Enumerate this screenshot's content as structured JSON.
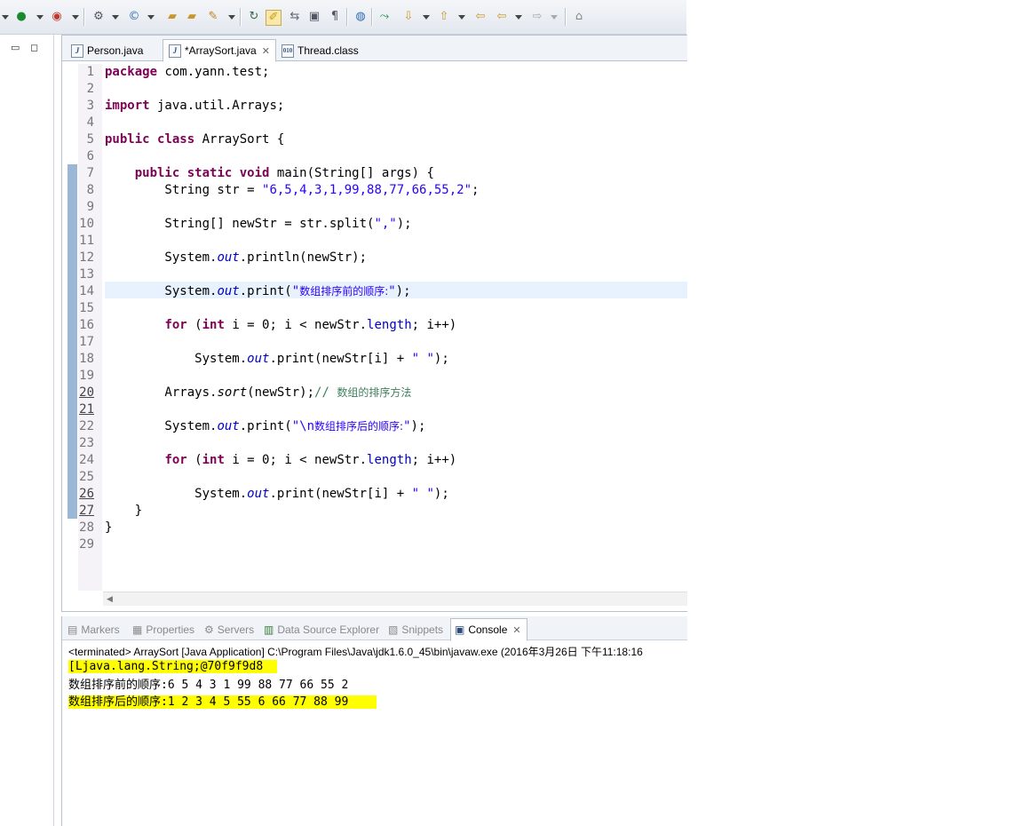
{
  "toolbar": {
    "icons": [
      "debug-icon",
      "run-icon",
      "external-tools-icon",
      "new-server-icon",
      "new-java-class-icon",
      "open-folder-icon",
      "open-type-icon",
      "search-icon",
      "toggle-mark-occurrences-icon",
      "toggle-highlight-icon",
      "toggle-block-icon",
      "show-whitespace-icon",
      "globe-icon",
      "next-annotation-icon",
      "previous-annotation-icon",
      "back-icon",
      "forward-icon",
      "pin-icon"
    ]
  },
  "editor": {
    "tabs": [
      {
        "label": "Person.java",
        "active": false,
        "closable": false
      },
      {
        "label": "*ArraySort.java",
        "active": true,
        "closable": true
      },
      {
        "label": "Thread.class",
        "active": false,
        "closable": false
      }
    ],
    "close_glyph": "✕",
    "code_lines": [
      "package com.yann.test;",
      "",
      "import java.util.Arrays;",
      "",
      "public class ArraySort {",
      "",
      "    public static void main(String[] args) {",
      "        String str = \"6,5,4,3,1,99,88,77,66,55,2\";",
      "",
      "        String[] newStr = str.split(\",\");",
      "",
      "        System.out.println(newStr);",
      "",
      "        System.out.print(\"数组排序前的顺序:\");",
      "",
      "        for (int i = 0; i < newStr.length; i++)",
      "",
      "            System.out.print(newStr[i] + \" \");",
      "",
      "        Arrays.sort(newStr);// 数组的排序方法",
      "",
      "        System.out.print(\"\\n数组排序后的顺序:\");",
      "",
      "        for (int i = 0; i < newStr.length; i++)",
      "",
      "            System.out.print(newStr[i] + \" \");",
      "    }",
      "}",
      ""
    ],
    "line_numbers": [
      "1",
      "2",
      "3",
      "4",
      "5",
      "6",
      "7",
      "8",
      "9",
      "10",
      "11",
      "12",
      "13",
      "14",
      "15",
      "16",
      "17",
      "18",
      "19",
      "20",
      "21",
      "22",
      "23",
      "24",
      "25",
      "26",
      "27",
      "28",
      "29"
    ]
  },
  "console": {
    "tabs": [
      {
        "label": "Markers",
        "icon": "markers-icon",
        "active": false
      },
      {
        "label": "Properties",
        "icon": "properties-icon",
        "active": false
      },
      {
        "label": "Servers",
        "icon": "servers-icon",
        "active": false
      },
      {
        "label": "Data Source Explorer",
        "icon": "data-source-icon",
        "active": false
      },
      {
        "label": "Snippets",
        "icon": "snippets-icon",
        "active": false
      },
      {
        "label": "Console",
        "icon": "console-icon",
        "active": true
      }
    ],
    "close_glyph": "✕",
    "terminated_line": "<terminated> ArraySort [Java Application] C:\\Program Files\\Java\\jdk1.6.0_45\\bin\\javaw.exe (2016年3月26日 下午11:18:16",
    "output_lines": [
      "[Ljava.lang.String;@70f9f9d8",
      "数组排序前的顺序:6 5 4 3 1 99 88 77 66 55 2",
      "数组排序后的顺序:1 2 3 4 5 55 6 66 77 88 99"
    ],
    "highlight_color": "#ffff00"
  }
}
